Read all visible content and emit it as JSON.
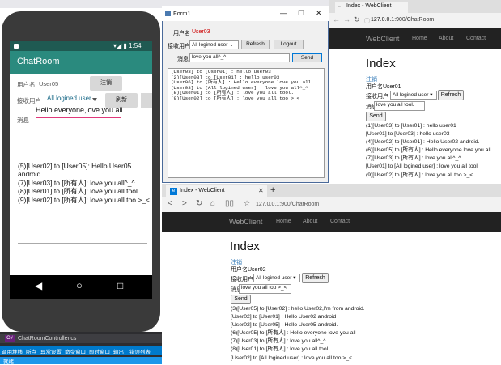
{
  "ide": {
    "title": "",
    "tab_label": "ChatRoomController.cs",
    "menu": [
      "调用堆栈",
      "断点",
      "异常设置",
      "命令窗口",
      "即时窗口",
      "输出",
      "错误列表"
    ],
    "status": "就绪"
  },
  "android": {
    "status_time": "1:54",
    "app_title": "ChatRoom",
    "username_label": "用户名",
    "username_value": "User05",
    "logout_button": "注销",
    "receiver_label": "接收用户",
    "receiver_value": "All logined user",
    "refresh_button": "刷新",
    "message_label": "消息",
    "message_value": "Hello everyone,love you all",
    "log": [
      "(5)[User02] to [User05]: Hello User05",
      "android.",
      "(7)[User03] to [所有人]: love you all^_^",
      "(8)[User01] to [所有人]: love you all tool.",
      "(9)[User02] to [所有人]: love you all too >_<"
    ]
  },
  "winform": {
    "title": "Form1",
    "username_label": "用户名",
    "username_value": "User03",
    "receiver_label": "接收用户",
    "receiver_value": "All logined user",
    "refresh_button": "Refresh",
    "logout_button": "Logout",
    "message_label": "消息",
    "message_value": "love you all^_^",
    "send_button": "Send",
    "log": [
      "[User03] to [User01] : hello user03",
      "(2)[User03] to [User01] : hello user03",
      "[User06] to [所有人] : Hello everyone love you all",
      "[User03] to [All logined user] : love you all^_^",
      "(8)[User01] to [所有人] : love you all tool.",
      "(9)[User02] to [所有人] : love you all too >_<"
    ]
  },
  "browser1": {
    "tab_title": "Index - WebClient",
    "url_host": "127.0.0.1",
    "url_path": ":900/ChatRoom",
    "brand": "WebClient",
    "nav": [
      "Home",
      "About",
      "Contact"
    ],
    "heading": "Index",
    "logout_link": "注销",
    "user_line": "用户名User01",
    "receiver_label": "接收用户",
    "receiver_value": "All logined user",
    "refresh_button": "Refresh",
    "message_label": "消息",
    "message_value": "love you all tool.",
    "send_button": "Send",
    "log": [
      "(1)[User03] to [User01] : hello user01",
      "[User01] to [User03] : hello user03",
      "(4)[User02] to [User01] : Hello User02 android.",
      "(6)[User05] to [所有人] : Hello everyone love you all",
      "(7)[User03] to [所有人] : love you all^_^",
      "[User01] to [All logined user] : love you all tool",
      "(9)[User02] to [所有人] : love you all too >_<"
    ]
  },
  "browser2": {
    "tab_title": "Index - WebClient",
    "url": "127.0.0.1:900/ChatRoom",
    "brand": "WebClient",
    "nav": [
      "Home",
      "About",
      "Contact"
    ],
    "heading": "Index",
    "logout_link": "注销",
    "user_line": "用户名User02",
    "receiver_label": "接收用户",
    "receiver_value": "All logined user",
    "refresh_button": "Refresh",
    "message_label": "消息",
    "message_value": "love you all too >_<",
    "send_button": "Send",
    "log": [
      "(3)[User05] to [User02] : hello User02,I'm from android.",
      "[User02] to [User01] : Hello User02 android",
      "[User02] to [User05] : Hello User05 android.",
      "(6)[User05] to [所有人] : Hello everyone love you all",
      "(7)[User03] to [所有人] : love you all^_^",
      "(8)[User01] to [所有人] : love you all tool.",
      "[User02] to [All logined user] : love you all too >_<"
    ]
  },
  "colors": {
    "android_appbar": "#2a8a7e",
    "android_statusbar": "#1f5a52",
    "input_underline": "#e0387a",
    "navbar_dark": "#222222",
    "link_blue": "#337ab7",
    "ide_blue": "#007acc"
  }
}
